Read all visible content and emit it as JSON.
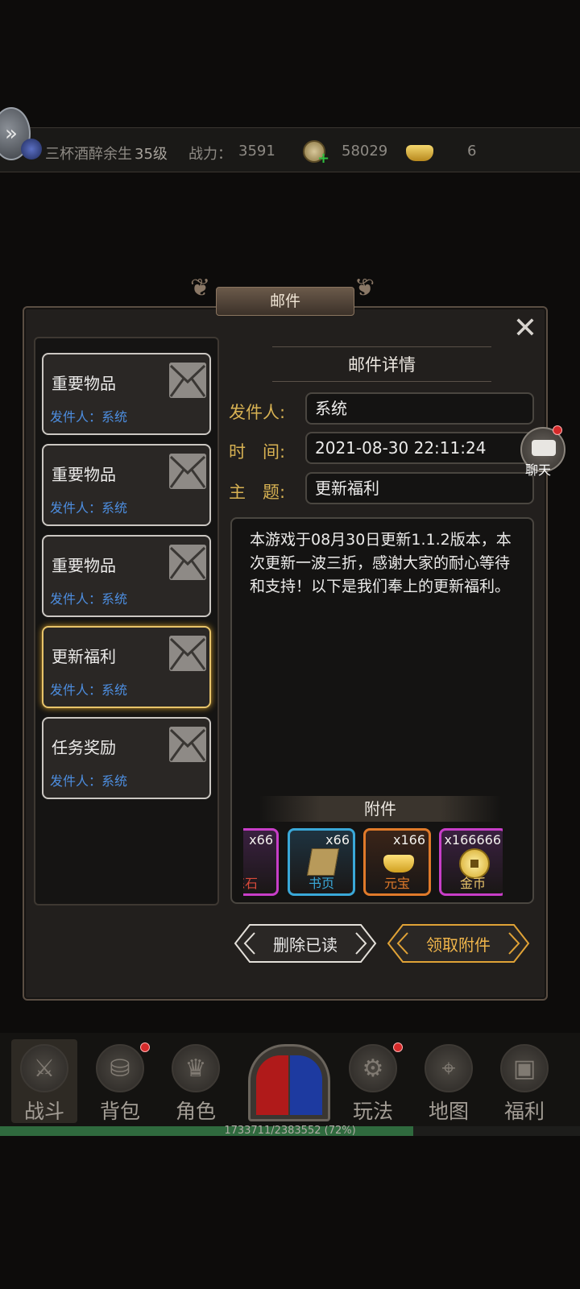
{
  "status": {
    "player_name": "三杯酒醉余生",
    "level": "35级",
    "power_label": "战力：",
    "power_value": "3591",
    "coins": "58029",
    "ingots": "6"
  },
  "dialog": {
    "title": "邮件",
    "close_icon": "close-icon"
  },
  "mail_list": [
    {
      "title": "重要物品",
      "sender": "发件人：系统"
    },
    {
      "title": "重要物品",
      "sender": "发件人：系统"
    },
    {
      "title": "重要物品",
      "sender": "发件人：系统"
    },
    {
      "title": "更新福利",
      "sender": "发件人：系统"
    },
    {
      "title": "任务奖励",
      "sender": "发件人：系统"
    }
  ],
  "detail": {
    "heading": "邮件详情",
    "sender_label": "发件人:",
    "sender_value": "系统",
    "time_label": "时　间:",
    "time_value": "2021-08-30 22:11:24",
    "subject_label": "主　题:",
    "subject_value": "更新福利",
    "body": "本游戏于08月30日更新1.1.2版本，本次更新一波三折，感谢大家的耐心等待和支持！以下是我们奉上的更新福利。"
  },
  "attachments": {
    "label": "附件",
    "items": [
      {
        "name": "炼石",
        "count": "x66",
        "border": "#c83ec8"
      },
      {
        "name": "书页",
        "count": "x66",
        "border": "#3aa8d8"
      },
      {
        "name": "元宝",
        "count": "x166",
        "border": "#e07a2a"
      },
      {
        "name": "金币",
        "count": "x166666",
        "border": "#c83ec8"
      }
    ]
  },
  "buttons": {
    "delete_read": "删除已读",
    "claim_attachments": "领取附件"
  },
  "chat": {
    "label": "聊天"
  },
  "nav": [
    {
      "label": "战斗",
      "icon": "crossed-swords-icon"
    },
    {
      "label": "背包",
      "icon": "backpack-icon"
    },
    {
      "label": "角色",
      "icon": "character-icon"
    },
    {
      "label": "玩法",
      "icon": "gameplay-icon"
    },
    {
      "label": "地图",
      "icon": "map-icon"
    },
    {
      "label": "福利",
      "icon": "treasure-chest-icon"
    }
  ],
  "xp": {
    "text": "1733711/2383552 (72%)",
    "fraction": 0.72
  }
}
